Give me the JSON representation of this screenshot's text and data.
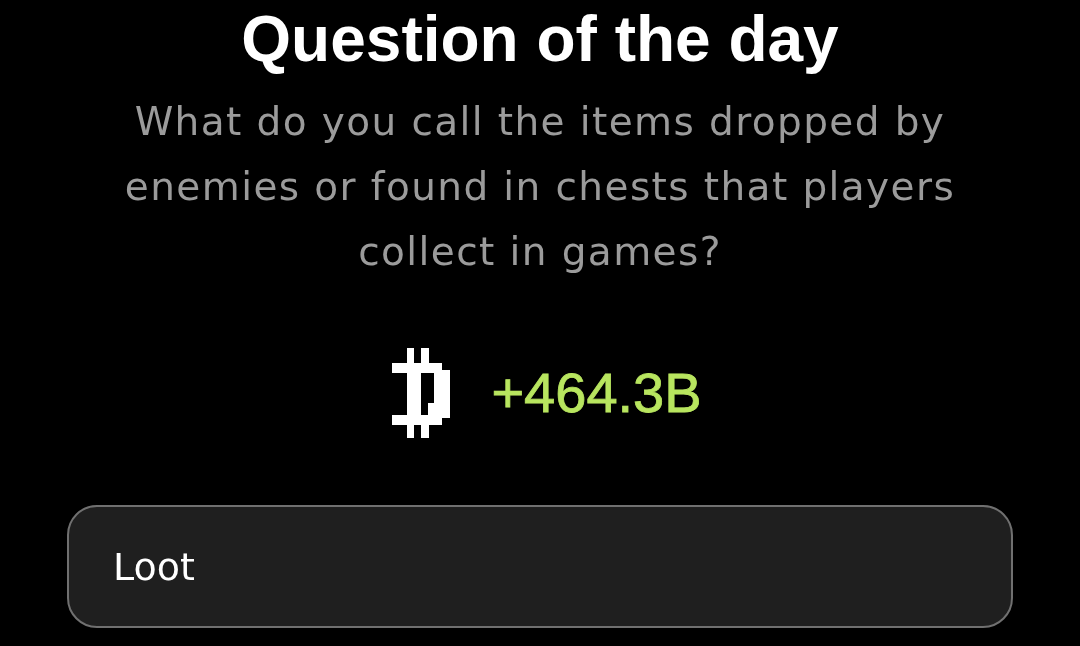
{
  "title": "Question of the day",
  "question": "What do you call the items dropped by enemies or found in chests that players collect in games?",
  "reward": {
    "amount": "+464.3B"
  },
  "answer_field": {
    "value": "Loot"
  }
}
